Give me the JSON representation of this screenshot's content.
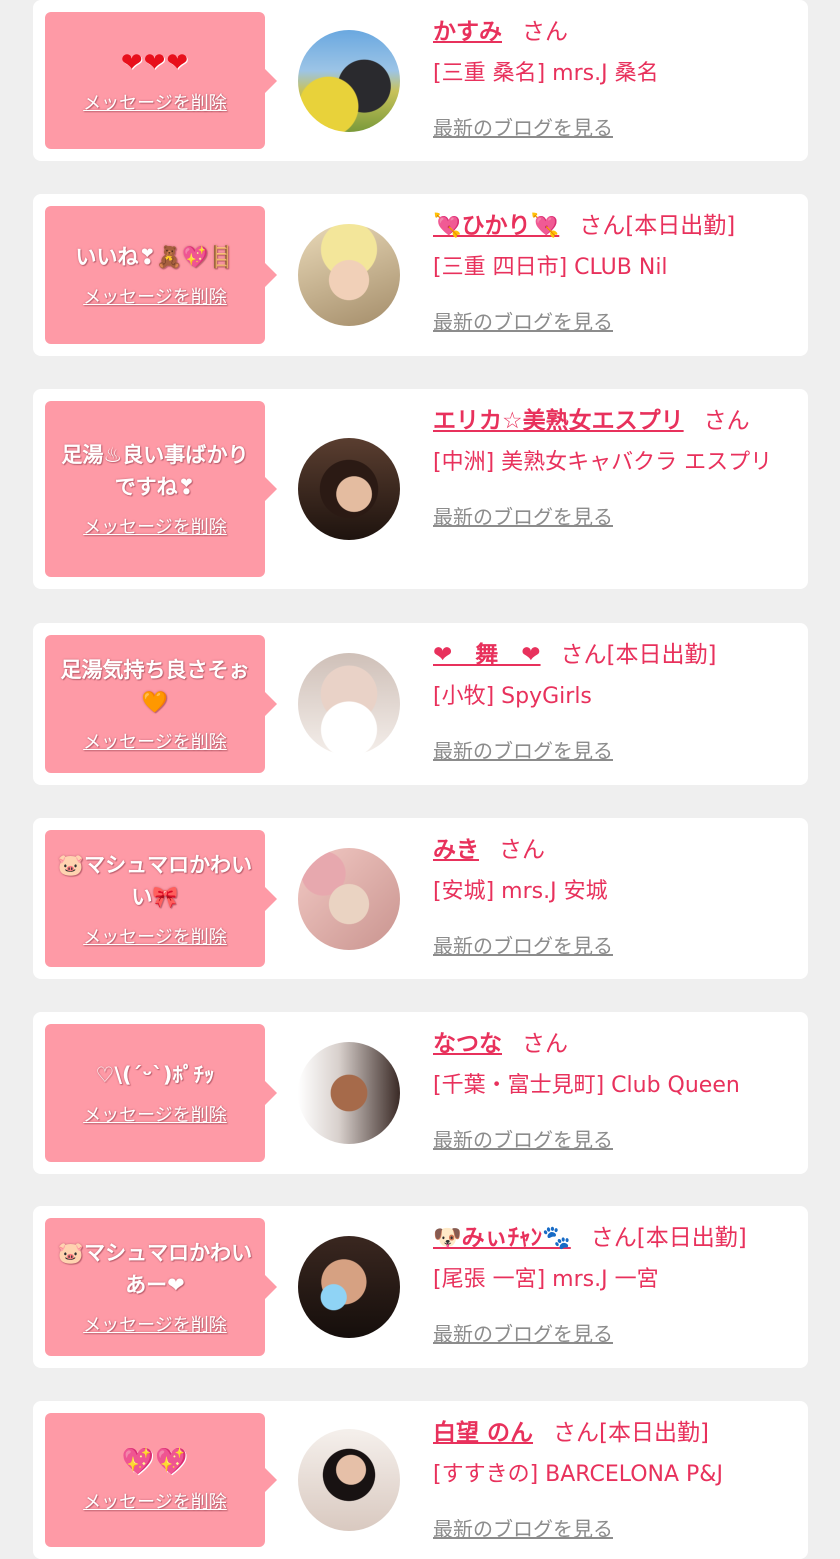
{
  "delete_label": "メッセージを削除",
  "blog_label": "最新のブログを見る",
  "honorific": "さん",
  "accent_color": "#e8315c",
  "bubble_color": "#fe9aa6",
  "items": [
    {
      "message": "❤❤❤",
      "name": "かすみ",
      "status": "",
      "shop": "[三重 桑名] mrs.J 桑名",
      "avatar": "woman-in-field"
    },
    {
      "message": "いいね❣🧸💖🪜",
      "name": "💘ひかり💘",
      "status": "[本日出勤]",
      "shop": "[三重 四日市] CLUB Nil",
      "avatar": "woman-flower-crown"
    },
    {
      "message": "足湯♨良い事ばかりですね❣",
      "name": "エリカ☆美熟女エスプリ",
      "status": "",
      "shop": "[中洲] 美熟女キャバクラ エスプリ",
      "avatar": "woman-dark-hair"
    },
    {
      "message": "足湯気持ち良さそぉ🧡",
      "name": "❤　舞　❤",
      "status": "[本日出勤]",
      "shop": "[小牧] SpyGirls",
      "avatar": "woman-cat-filter"
    },
    {
      "message": "🐷マシュマロかわいい🎀",
      "name": "みき",
      "status": "",
      "shop": "[安城] mrs.J 安城",
      "avatar": "woman-rose-frame"
    },
    {
      "message": "♡\\(ˊᵕˋ)ﾎﾟﾁｯ",
      "name": "なつな",
      "status": "",
      "shop": "[千葉・富士見町] Club Queen",
      "avatar": "woman-sitting"
    },
    {
      "message": "🐷マシュマロかわいあー❤",
      "name": "🐶みぃﾁｬﾝ🐾",
      "status": "[本日出勤]",
      "shop": "[尾張 一宮] mrs.J 一宮",
      "avatar": "woman-heart-sticker"
    },
    {
      "message": "💖💖",
      "name": "白望 のん",
      "status": "[本日出勤]",
      "shop": "[すすきの] BARCELONA P&J",
      "avatar": "woman-portrait"
    }
  ]
}
